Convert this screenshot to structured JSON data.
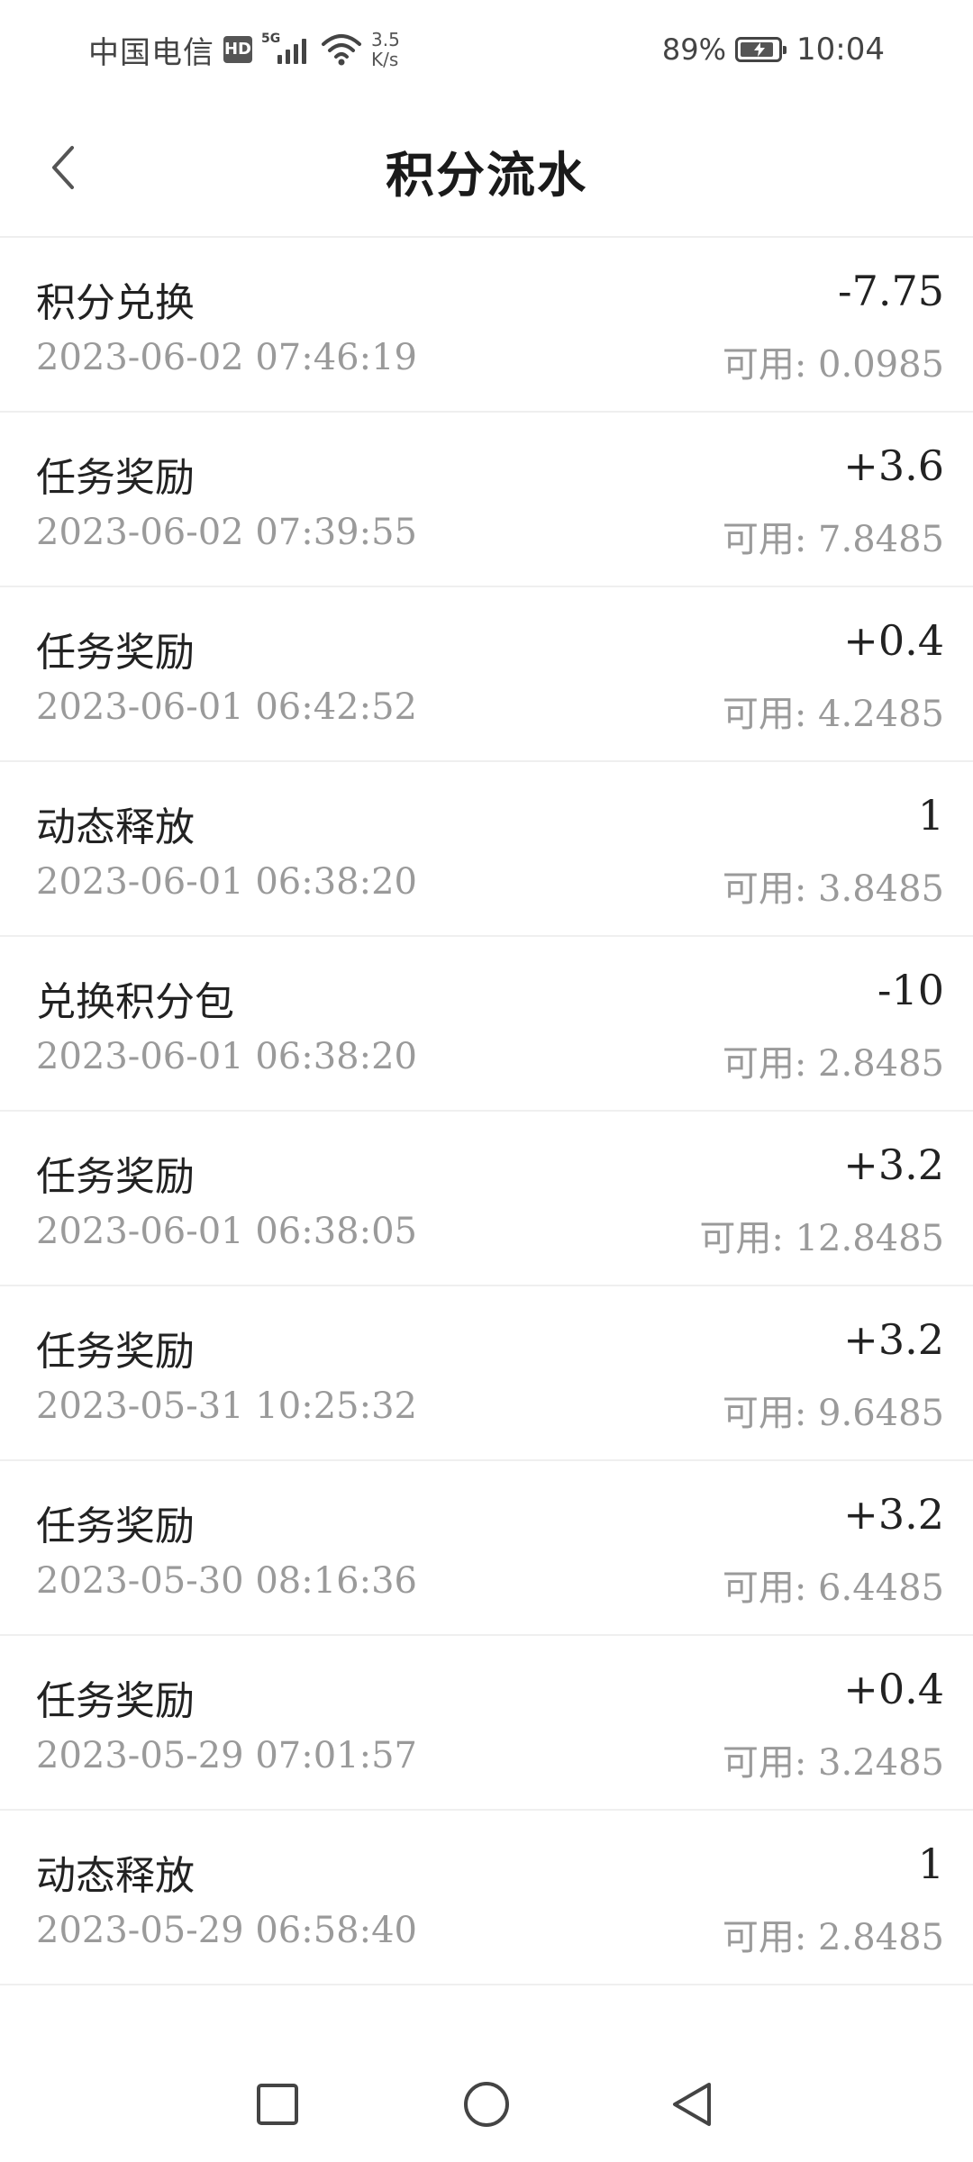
{
  "status_bar": {
    "carrier": "中国电信",
    "hd_badge": "HD",
    "network": "5G",
    "speed_value": "3.5",
    "speed_unit": "K/s",
    "battery_percent": "89%",
    "battery_level": 0.89,
    "time": "10:04"
  },
  "header": {
    "title": "积分流水",
    "back_icon": "chevron-left-icon"
  },
  "transactions": [
    {
      "title": "积分兑换",
      "time": "2023-06-02 07:46:19",
      "amount": "-7.75",
      "available": "可用: 0.0985"
    },
    {
      "title": "任务奖励",
      "time": "2023-06-02 07:39:55",
      "amount": "+3.6",
      "available": "可用: 7.8485"
    },
    {
      "title": "任务奖励",
      "time": "2023-06-01 06:42:52",
      "amount": "+0.4",
      "available": "可用: 4.2485"
    },
    {
      "title": "动态释放",
      "time": "2023-06-01 06:38:20",
      "amount": "1",
      "available": "可用: 3.8485"
    },
    {
      "title": "兑换积分包",
      "time": "2023-06-01 06:38:20",
      "amount": "-10",
      "available": "可用: 2.8485"
    },
    {
      "title": "任务奖励",
      "time": "2023-06-01 06:38:05",
      "amount": "+3.2",
      "available": "可用: 12.8485"
    },
    {
      "title": "任务奖励",
      "time": "2023-05-31 10:25:32",
      "amount": "+3.2",
      "available": "可用: 9.6485"
    },
    {
      "title": "任务奖励",
      "time": "2023-05-30 08:16:36",
      "amount": "+3.2",
      "available": "可用: 6.4485"
    },
    {
      "title": "任务奖励",
      "time": "2023-05-29 07:01:57",
      "amount": "+0.4",
      "available": "可用: 3.2485"
    },
    {
      "title": "动态释放",
      "time": "2023-05-29 06:58:40",
      "amount": "1",
      "available": "可用: 2.8485"
    }
  ],
  "nav_bar": {
    "recents_icon": "square-icon",
    "home_icon": "circle-icon",
    "back_icon": "triangle-back-icon"
  },
  "colors": {
    "text_primary": "#222222",
    "text_secondary": "#9a9a9a",
    "divider": "#efefef",
    "background": "#ffffff"
  }
}
